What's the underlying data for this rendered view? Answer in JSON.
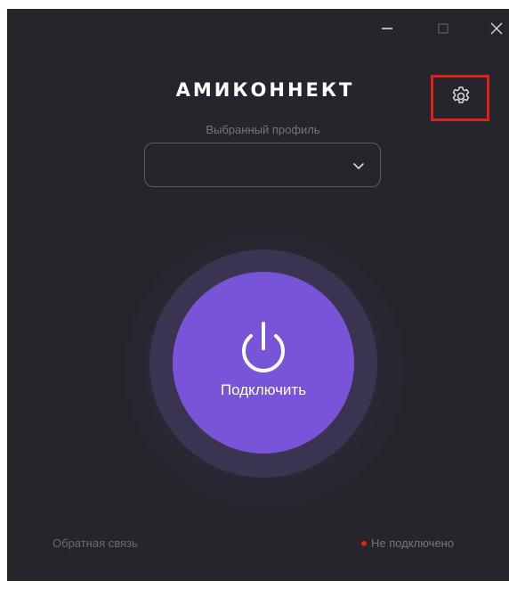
{
  "app": {
    "logo_text": "АМИКОННЕКТ"
  },
  "titlebar": {
    "minimize_icon": "minimize-icon",
    "maximize_icon": "maximize-icon",
    "close_icon": "close-icon"
  },
  "settings": {
    "icon": "gear-icon",
    "highlight_color": "#e0201d"
  },
  "profile": {
    "label": "Выбранный профиль",
    "selected_value": ""
  },
  "connect": {
    "label": "Подключить",
    "icon": "power-icon",
    "accent_color": "#7855d8"
  },
  "footer": {
    "feedback_link": "Обратная связь",
    "status_text": "Не подключено",
    "status_color": "#e0201d"
  },
  "colors": {
    "background": "#27252c"
  }
}
